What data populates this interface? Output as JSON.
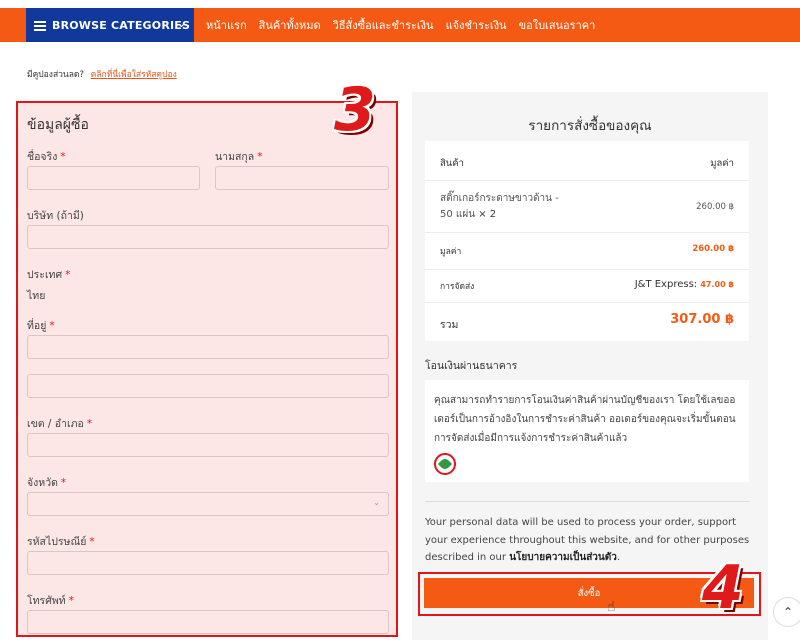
{
  "nav": {
    "browse_label": "BROWSE CATEGORIES",
    "links": [
      "หน้าแรก",
      "สินค้าทั้งหมด",
      "วิธีสั่งซื้อและชำระเงิน",
      "แจ้งชำระเงิน",
      "ขอใบเสนอราคา"
    ]
  },
  "coupon": {
    "text": "มีคูปองส่วนลด?",
    "link": "คลิกที่นี่เพื่อใส่รหัสคูปอง"
  },
  "billing": {
    "title": "ข้อมูลผู้ซื้อ",
    "required_mark": "*",
    "first_name": "ชื่อจริง",
    "last_name": "นามสกุล",
    "company": "บริษัท (ถ้ามี)",
    "country_label": "ประเทศ",
    "country_value": "ไทย",
    "address": "ที่อยู่",
    "district": "เขต / อำเภอ",
    "province": "จังหวัด",
    "postcode": "รหัสไปรษณีย์",
    "phone": "โทรศัพท์"
  },
  "annotations": {
    "step3": "3",
    "step4": "4"
  },
  "order": {
    "title": "รายการสั่งซื้อของคุณ",
    "col_product": "สินค้า",
    "col_value": "มูลค่า",
    "item_name_1": "สติ๊กเกอร์กระดาษขาวด้าน -",
    "item_name_2": "50 แผ่น",
    "item_qty": "× 2",
    "item_price": "260.00 ฿",
    "subtotal_label": "มูลค่า",
    "subtotal_value": "260.00 ฿",
    "shipping_label": "การจัดส่ง",
    "shipping_method": "J&T Express:",
    "shipping_price": "47.00 ฿",
    "total_label": "รวม",
    "total_value": "307.00 ฿",
    "bank_title": "โอนเงินผ่านธนาคาร",
    "bank_desc": "คุณสามารถทำรายการโอนเงินค่าสินค้าผ่านบัญชีของเรา โดยใช้เลขออเดอร์เป็นการอ้างอิงในการชำระค่าสินค้า ออเดอร์ของคุณจะเริ่มขั้นตอนการจัดส่งเมื่อมีการแจ้งการชำระค่าสินค้าแล้ว",
    "privacy_text": "Your personal data will be used to process your order, support your experience throughout this website, and for other purposes described in our",
    "privacy_link": "นโยบายความเป็นส่วนตัว",
    "privacy_end": ".",
    "place_order": "สั่งซื้อ"
  },
  "colors": {
    "accent": "#f45a14",
    "nav_blue": "#10399b",
    "annotation_red": "#e0161b"
  },
  "icons": [
    "menu-icon",
    "chevron-down-icon",
    "kasikorn-bank-icon",
    "hand-cursor-icon",
    "arrow-up-icon"
  ]
}
